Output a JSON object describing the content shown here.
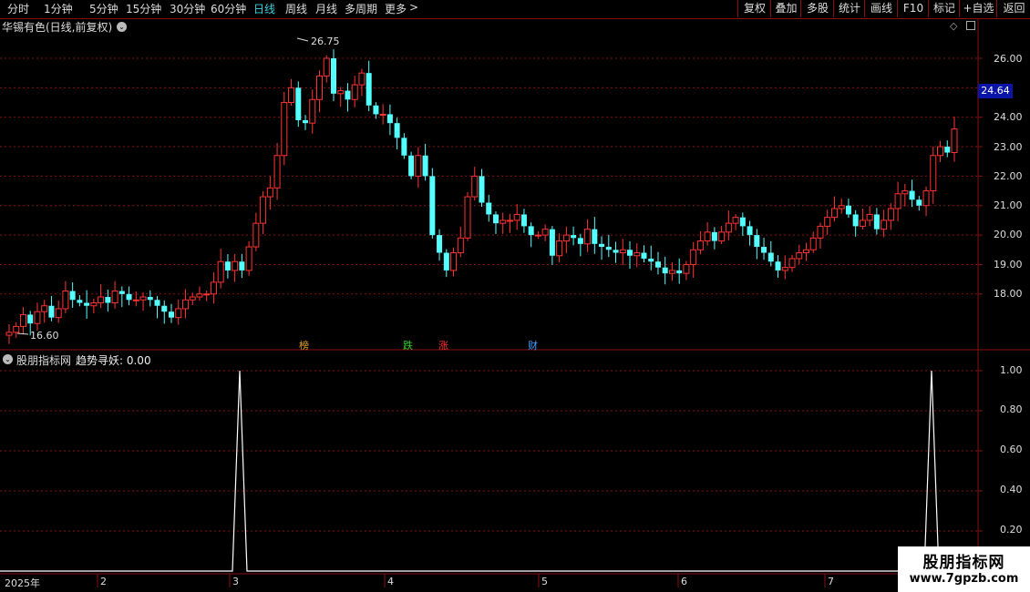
{
  "toolbar": {
    "periods": [
      "分时",
      "1分钟",
      "5分钟",
      "15分钟",
      "30分钟",
      "60分钟",
      "日线",
      "周线",
      "月线",
      "多周期",
      "更多"
    ],
    "active_period": "日线",
    "more_arrow": ">",
    "right_buttons": [
      "复权",
      "叠加",
      "多股",
      "统计",
      "画线",
      "F10",
      "标记",
      "+自选",
      "返回"
    ]
  },
  "stock": {
    "title": "华锡有色(日线,前复权)"
  },
  "price_axis": {
    "labels": [
      "26.00",
      "25.00",
      "24.00",
      "23.00",
      "22.00",
      "21.00",
      "20.00",
      "19.00",
      "18.00"
    ],
    "current_price": "24.64"
  },
  "annotations": {
    "high_label": "26.75",
    "low_label": "16.60"
  },
  "tags": [
    {
      "text": "榜",
      "color": "#e0a020"
    },
    {
      "text": "跌",
      "color": "#30d030"
    },
    {
      "text": "涨",
      "color": "#ff3030"
    },
    {
      "text": "财",
      "color": "#40a0ff"
    }
  ],
  "indicator": {
    "title": "股朋指标网",
    "name_value": "趋势寻妖: 0.00",
    "axis_labels": [
      "1.00",
      "0.80",
      "0.60",
      "0.40",
      "0.20"
    ]
  },
  "time_axis": {
    "labels": [
      "2025年",
      "2",
      "3",
      "4",
      "5",
      "6",
      "7"
    ]
  },
  "watermark": {
    "line1": "股朋指标网",
    "line2": "www.7gpzb.com"
  },
  "colors": {
    "up": "#ff3333",
    "down": "#54ffff",
    "accent": "#3ad0e0",
    "grid": "#8a1010",
    "price_box": "#0a15a8"
  },
  "chart_data": [
    {
      "type": "candlestick",
      "title": "华锡有色(日线,前复权)",
      "ylim": [
        16.6,
        26.75
      ],
      "y_ticks": [
        18,
        19,
        20,
        21,
        22,
        23,
        24,
        25,
        26
      ],
      "high": 26.75,
      "low": 16.6,
      "last": 24.64,
      "closes": [
        16.7,
        16.9,
        17.3,
        17.0,
        17.4,
        17.6,
        17.2,
        17.5,
        18.1,
        17.8,
        17.7,
        17.6,
        17.7,
        17.9,
        17.7,
        18.1,
        18.0,
        17.8,
        17.8,
        17.9,
        17.8,
        17.6,
        17.4,
        17.2,
        17.5,
        17.8,
        17.9,
        18.0,
        18.0,
        18.4,
        19.1,
        18.8,
        19.1,
        18.8,
        19.6,
        20.4,
        21.3,
        21.6,
        22.7,
        24.5,
        25.0,
        23.9,
        23.8,
        24.6,
        25.4,
        26.0,
        24.8,
        24.9,
        24.6,
        25.1,
        25.5,
        24.4,
        24.1,
        24.1,
        23.8,
        23.3,
        22.7,
        22.0,
        22.7,
        22.0,
        20.0,
        19.4,
        18.8,
        19.4,
        19.9,
        21.3,
        22.0,
        21.1,
        20.7,
        20.4,
        20.5,
        20.5,
        20.7,
        20.3,
        20.0,
        20.0,
        20.2,
        19.3,
        19.8,
        20.0,
        19.9,
        19.7,
        20.2,
        19.7,
        19.6,
        19.5,
        19.4,
        19.5,
        19.3,
        19.4,
        19.2,
        19.1,
        18.9,
        18.7,
        18.8,
        18.7,
        19.0,
        19.5,
        19.8,
        20.1,
        19.8,
        20.1,
        20.4,
        20.6,
        20.3,
        20.0,
        19.6,
        19.4,
        19.1,
        18.8,
        18.9,
        19.2,
        19.4,
        19.5,
        19.9,
        20.3,
        20.6,
        20.9,
        21.0,
        20.7,
        20.3,
        20.5,
        20.7,
        20.2,
        20.5,
        20.9,
        21.4,
        21.5,
        21.2,
        21.0,
        21.5,
        22.7,
        23.0,
        22.8,
        23.6
      ],
      "period": "daily",
      "months_shown": [
        "2025年",
        "2",
        "3",
        "4",
        "5",
        "6",
        "7"
      ]
    },
    {
      "type": "line",
      "title": "趋势寻妖",
      "ylim": [
        0,
        1.0
      ],
      "y_ticks": [
        0.2,
        0.4,
        0.6,
        0.8,
        1.0
      ],
      "last_value": 0.0,
      "spikes": [
        {
          "near": "2025-03 (early)",
          "value": 1.0
        },
        {
          "near": "2025-07 (end)",
          "value": 1.0
        }
      ]
    }
  ]
}
